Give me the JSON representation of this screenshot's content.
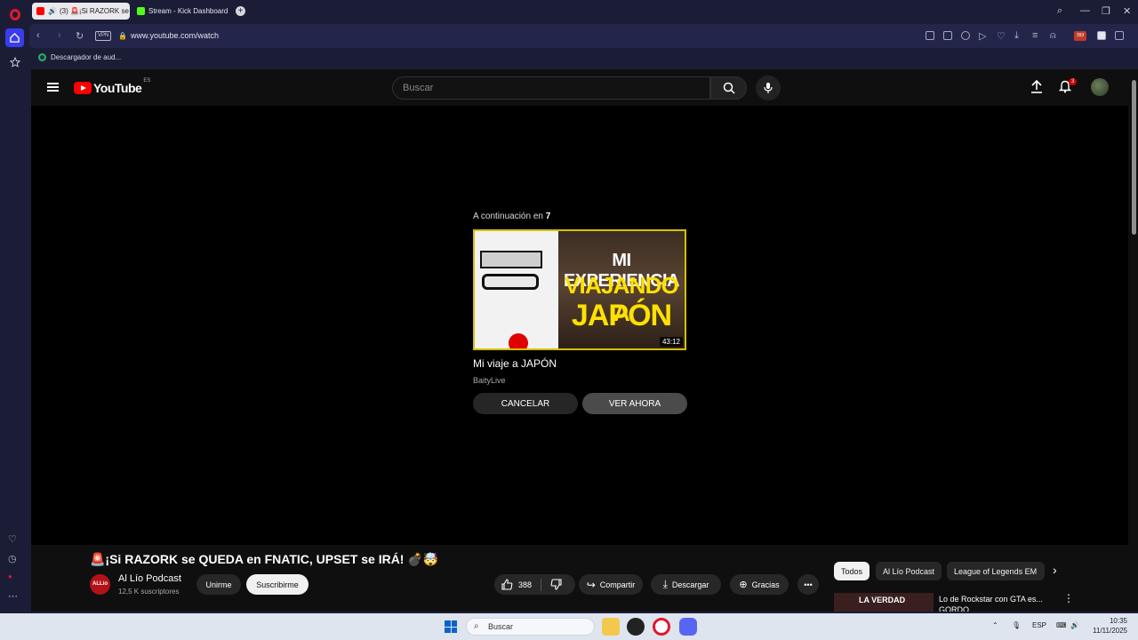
{
  "browser": {
    "tabs": [
      {
        "label": "(3) 🚨¡Si RAZORK se",
        "active": true
      },
      {
        "label": "Stream - Kick Dashboard",
        "active": false
      }
    ],
    "url": "www.youtube.com/watch",
    "vpn_label": "VPN",
    "bookmark": "Descargador de aud...",
    "badge_count": "393"
  },
  "youtube": {
    "logo_text": "YouTube",
    "country_code": "ES",
    "search_placeholder": "Buscar",
    "notifications_count": "3"
  },
  "up_next": {
    "label_prefix": "A continuación en",
    "countdown": "7",
    "thumb_line1": "MI EXPERIENCIA",
    "thumb_line2": "VIAJANDO A",
    "thumb_line3": "JAPÓN",
    "duration": "43:12",
    "title": "Mi viaje a JAPÓN",
    "channel": "BaityLive",
    "cancel_label": "CANCELAR",
    "watch_label": "VER AHORA"
  },
  "video": {
    "title": "🚨¡Si RAZORK se QUEDA en FNATIC, UPSET se IRÁ! 💣🤯",
    "channel_name": "Al Lío Podcast",
    "channel_avatar_text": "ALLío",
    "subscribers": "12,5 K suscriptores",
    "join_label": "Unirme",
    "subscribe_label": "Suscribirme",
    "likes": "388",
    "share_label": "Compartir",
    "download_label": "Descargar",
    "thanks_label": "Gracias"
  },
  "recommendations": {
    "chips": [
      "Todos",
      "Al Lío Podcast",
      "League of Legends EM"
    ],
    "first_thumb_text": "LA VERDAD",
    "first_title": "Lo de Rockstar con GTA es... GORDO"
  },
  "taskbar": {
    "search_label": "Buscar",
    "language": "ESP",
    "time": "10:35",
    "date": "11/11/2025"
  },
  "colors": {
    "youtube_red": "#ff0000",
    "opera_red": "#e0182d",
    "sidebar_bg": "#1b1d36",
    "page_bg": "#0f0f0f"
  }
}
